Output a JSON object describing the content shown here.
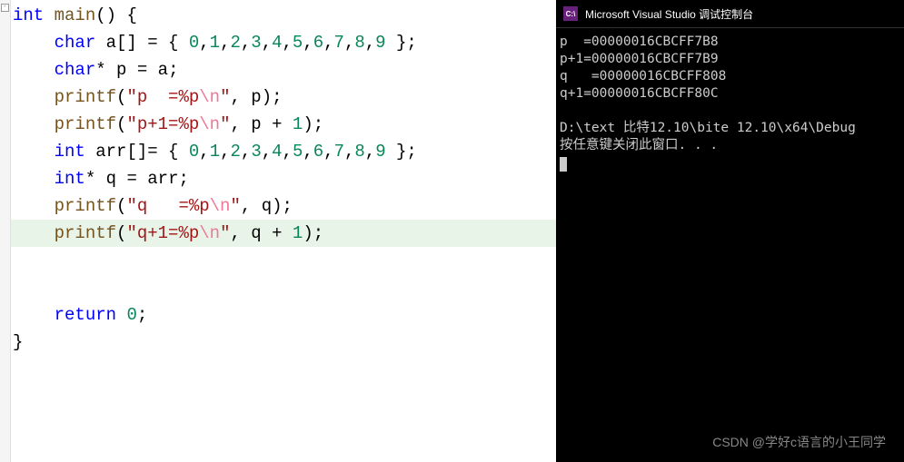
{
  "editor": {
    "code_lines": [
      {
        "indent": 0,
        "tokens": [
          [
            "kw",
            "int"
          ],
          [
            "punct",
            " "
          ],
          [
            "fn",
            "main"
          ],
          [
            "punct",
            "() {"
          ]
        ]
      },
      {
        "indent": 1,
        "tokens": [
          [
            "kw",
            "char"
          ],
          [
            "punct",
            " "
          ],
          [
            "id",
            "a"
          ],
          [
            "punct",
            "[] = { "
          ],
          [
            "num",
            "0"
          ],
          [
            "punct",
            ","
          ],
          [
            "num",
            "1"
          ],
          [
            "punct",
            ","
          ],
          [
            "num",
            "2"
          ],
          [
            "punct",
            ","
          ],
          [
            "num",
            "3"
          ],
          [
            "punct",
            ","
          ],
          [
            "num",
            "4"
          ],
          [
            "punct",
            ","
          ],
          [
            "num",
            "5"
          ],
          [
            "punct",
            ","
          ],
          [
            "num",
            "6"
          ],
          [
            "punct",
            ","
          ],
          [
            "num",
            "7"
          ],
          [
            "punct",
            ","
          ],
          [
            "num",
            "8"
          ],
          [
            "punct",
            ","
          ],
          [
            "num",
            "9"
          ],
          [
            "punct",
            " };"
          ]
        ]
      },
      {
        "indent": 1,
        "tokens": [
          [
            "kw",
            "char"
          ],
          [
            "punct",
            "* "
          ],
          [
            "id",
            "p"
          ],
          [
            "punct",
            " = "
          ],
          [
            "id",
            "a"
          ],
          [
            "punct",
            ";"
          ]
        ]
      },
      {
        "indent": 1,
        "tokens": [
          [
            "fn",
            "printf"
          ],
          [
            "punct",
            "("
          ],
          [
            "str",
            "\"p  =%p"
          ],
          [
            "esc",
            "\\n"
          ],
          [
            "str",
            "\""
          ],
          [
            "punct",
            ", "
          ],
          [
            "id",
            "p"
          ],
          [
            "punct",
            ");"
          ]
        ]
      },
      {
        "indent": 1,
        "tokens": [
          [
            "fn",
            "printf"
          ],
          [
            "punct",
            "("
          ],
          [
            "str",
            "\"p+1=%p"
          ],
          [
            "esc",
            "\\n"
          ],
          [
            "str",
            "\""
          ],
          [
            "punct",
            ", "
          ],
          [
            "id",
            "p"
          ],
          [
            "punct",
            " + "
          ],
          [
            "num",
            "1"
          ],
          [
            "punct",
            ");"
          ]
        ]
      },
      {
        "indent": 1,
        "tokens": [
          [
            "kw",
            "int"
          ],
          [
            "punct",
            " "
          ],
          [
            "id",
            "arr"
          ],
          [
            "punct",
            "[]= { "
          ],
          [
            "num",
            "0"
          ],
          [
            "punct",
            ","
          ],
          [
            "num",
            "1"
          ],
          [
            "punct",
            ","
          ],
          [
            "num",
            "2"
          ],
          [
            "punct",
            ","
          ],
          [
            "num",
            "3"
          ],
          [
            "punct",
            ","
          ],
          [
            "num",
            "4"
          ],
          [
            "punct",
            ","
          ],
          [
            "num",
            "5"
          ],
          [
            "punct",
            ","
          ],
          [
            "num",
            "6"
          ],
          [
            "punct",
            ","
          ],
          [
            "num",
            "7"
          ],
          [
            "punct",
            ","
          ],
          [
            "num",
            "8"
          ],
          [
            "punct",
            ","
          ],
          [
            "num",
            "9"
          ],
          [
            "punct",
            " };"
          ]
        ]
      },
      {
        "indent": 1,
        "tokens": [
          [
            "kw",
            "int"
          ],
          [
            "punct",
            "* "
          ],
          [
            "id",
            "q"
          ],
          [
            "punct",
            " = "
          ],
          [
            "id",
            "arr"
          ],
          [
            "punct",
            ";"
          ]
        ]
      },
      {
        "indent": 1,
        "tokens": [
          [
            "fn",
            "printf"
          ],
          [
            "punct",
            "("
          ],
          [
            "str",
            "\"q   =%p"
          ],
          [
            "esc",
            "\\n"
          ],
          [
            "str",
            "\""
          ],
          [
            "punct",
            ", "
          ],
          [
            "id",
            "q"
          ],
          [
            "punct",
            ");"
          ]
        ]
      },
      {
        "indent": 1,
        "tokens": [
          [
            "fn",
            "printf"
          ],
          [
            "punct",
            "("
          ],
          [
            "str",
            "\"q+1=%p"
          ],
          [
            "esc",
            "\\n"
          ],
          [
            "str",
            "\""
          ],
          [
            "punct",
            ", "
          ],
          [
            "id",
            "q"
          ],
          [
            "punct",
            " + "
          ],
          [
            "num",
            "1"
          ],
          [
            "punct",
            ");"
          ]
        ]
      },
      {
        "indent": 0,
        "tokens": []
      },
      {
        "indent": 0,
        "tokens": []
      },
      {
        "indent": 1,
        "tokens": [
          [
            "kw",
            "return"
          ],
          [
            "punct",
            " "
          ],
          [
            "num",
            "0"
          ],
          [
            "punct",
            ";"
          ]
        ]
      },
      {
        "indent": 0,
        "tokens": [
          [
            "punct",
            "}"
          ]
        ]
      }
    ],
    "highlighted_line_index": 8
  },
  "console": {
    "title": "Microsoft Visual Studio 调试控制台",
    "icon_text": "C:\\",
    "output_lines": [
      "p  =00000016CBCFF7B8",
      "p+1=00000016CBCFF7B9",
      "q   =00000016CBCFF808",
      "q+1=00000016CBCFF80C",
      "",
      "D:\\text 比特12.10\\bite 12.10\\x64\\Debug",
      "按任意键关闭此窗口. . ."
    ]
  },
  "watermark": "CSDN @学好c语言的小王同学"
}
